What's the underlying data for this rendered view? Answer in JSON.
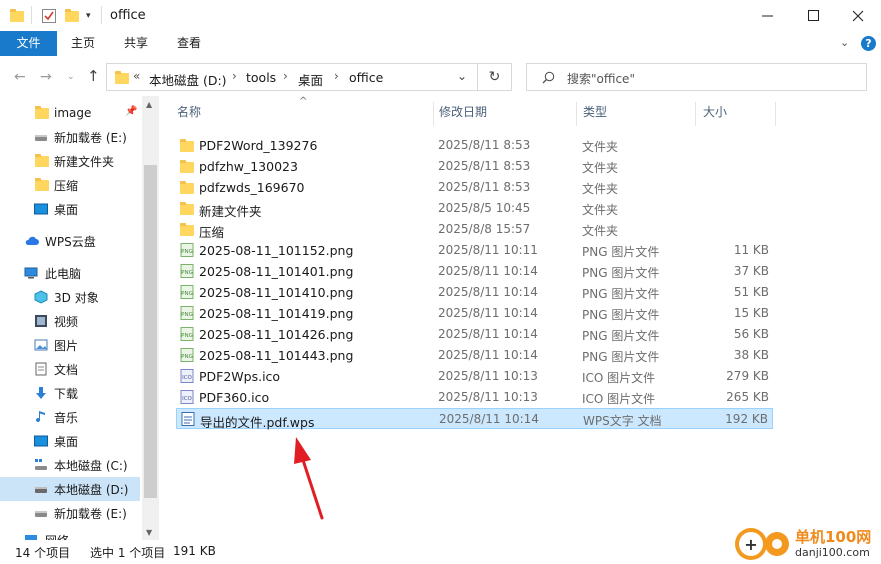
{
  "window": {
    "title": "office",
    "minimize_icon": "minimize-icon",
    "maximize_icon": "maximize-icon",
    "close_icon": "close-icon"
  },
  "ribbon": {
    "tabs": [
      "文件",
      "主页",
      "共享",
      "查看"
    ],
    "expand_icon": "chevron-down-icon",
    "help_icon": "help-icon"
  },
  "address": {
    "overflow": "«",
    "crumbs": [
      "本地磁盘 (D:)",
      "tools",
      "桌面",
      "office"
    ],
    "search_placeholder": "搜索\"office\""
  },
  "nav": {
    "items": [
      {
        "label": "image",
        "icon": "folder-icon",
        "pinned": true
      },
      {
        "label": "新加载卷 (E:)",
        "icon": "drive-icon"
      },
      {
        "label": "新建文件夹",
        "icon": "folder-icon"
      },
      {
        "label": "压缩",
        "icon": "folder-icon"
      },
      {
        "label": "桌面",
        "icon": "desktop-icon"
      },
      {
        "label": "WPS云盘",
        "icon": "cloud-icon"
      },
      {
        "label": "此电脑",
        "icon": "computer-icon"
      },
      {
        "label": "3D 对象",
        "icon": "cube-icon"
      },
      {
        "label": "视频",
        "icon": "video-icon"
      },
      {
        "label": "图片",
        "icon": "picture-icon"
      },
      {
        "label": "文档",
        "icon": "document-icon"
      },
      {
        "label": "下载",
        "icon": "download-icon"
      },
      {
        "label": "音乐",
        "icon": "music-icon"
      },
      {
        "label": "桌面",
        "icon": "desktop-icon"
      },
      {
        "label": "本地磁盘 (C:)",
        "icon": "system-drive-icon"
      },
      {
        "label": "本地磁盘 (D:)",
        "icon": "drive-icon",
        "selected": true
      },
      {
        "label": "新加载卷 (E:)",
        "icon": "drive-icon"
      },
      {
        "label": "网络",
        "icon": "network-icon"
      }
    ]
  },
  "columns": [
    "名称",
    "修改日期",
    "类型",
    "大小"
  ],
  "files": [
    {
      "name": "PDF2Word_139276",
      "date": "2025/8/11 8:53",
      "type": "文件夹",
      "size": "",
      "icon": "folder-icon"
    },
    {
      "name": "pdfzhw_130023",
      "date": "2025/8/11 8:53",
      "type": "文件夹",
      "size": "",
      "icon": "folder-icon"
    },
    {
      "name": "pdfzwds_169670",
      "date": "2025/8/11 8:53",
      "type": "文件夹",
      "size": "",
      "icon": "folder-icon"
    },
    {
      "name": "新建文件夹",
      "date": "2025/8/5 10:45",
      "type": "文件夹",
      "size": "",
      "icon": "folder-icon"
    },
    {
      "name": "压缩",
      "date": "2025/8/8 15:57",
      "type": "文件夹",
      "size": "",
      "icon": "folder-icon"
    },
    {
      "name": "2025-08-11_101152.png",
      "date": "2025/8/11 10:11",
      "type": "PNG 图片文件",
      "size": "11 KB",
      "icon": "png-file-icon"
    },
    {
      "name": "2025-08-11_101401.png",
      "date": "2025/8/11 10:14",
      "type": "PNG 图片文件",
      "size": "37 KB",
      "icon": "png-file-icon"
    },
    {
      "name": "2025-08-11_101410.png",
      "date": "2025/8/11 10:14",
      "type": "PNG 图片文件",
      "size": "51 KB",
      "icon": "png-file-icon"
    },
    {
      "name": "2025-08-11_101419.png",
      "date": "2025/8/11 10:14",
      "type": "PNG 图片文件",
      "size": "15 KB",
      "icon": "png-file-icon"
    },
    {
      "name": "2025-08-11_101426.png",
      "date": "2025/8/11 10:14",
      "type": "PNG 图片文件",
      "size": "56 KB",
      "icon": "png-file-icon"
    },
    {
      "name": "2025-08-11_101443.png",
      "date": "2025/8/11 10:14",
      "type": "PNG 图片文件",
      "size": "38 KB",
      "icon": "png-file-icon"
    },
    {
      "name": "PDF2Wps.ico",
      "date": "2025/8/11 10:13",
      "type": "ICO 图片文件",
      "size": "279 KB",
      "icon": "ico-file-icon"
    },
    {
      "name": "PDF360.ico",
      "date": "2025/8/11 10:13",
      "type": "ICO 图片文件",
      "size": "265 KB",
      "icon": "ico-file-icon"
    },
    {
      "name": "导出的文件.pdf.wps",
      "date": "2025/8/11 10:14",
      "type": "WPS文字 文档",
      "size": "192 KB",
      "icon": "wps-document-icon",
      "selected": true
    }
  ],
  "status": {
    "count": "14 个项目",
    "selected": "选中 1 个项目",
    "size": "191 KB"
  },
  "watermark": {
    "text": "单机100网",
    "url": "danji100.com"
  },
  "colors": {
    "accent": "#1979ca",
    "selection": "#cce8ff",
    "selection_border": "#99d1ff",
    "folder": "#ffd75e",
    "arrow": "#e01e24"
  }
}
